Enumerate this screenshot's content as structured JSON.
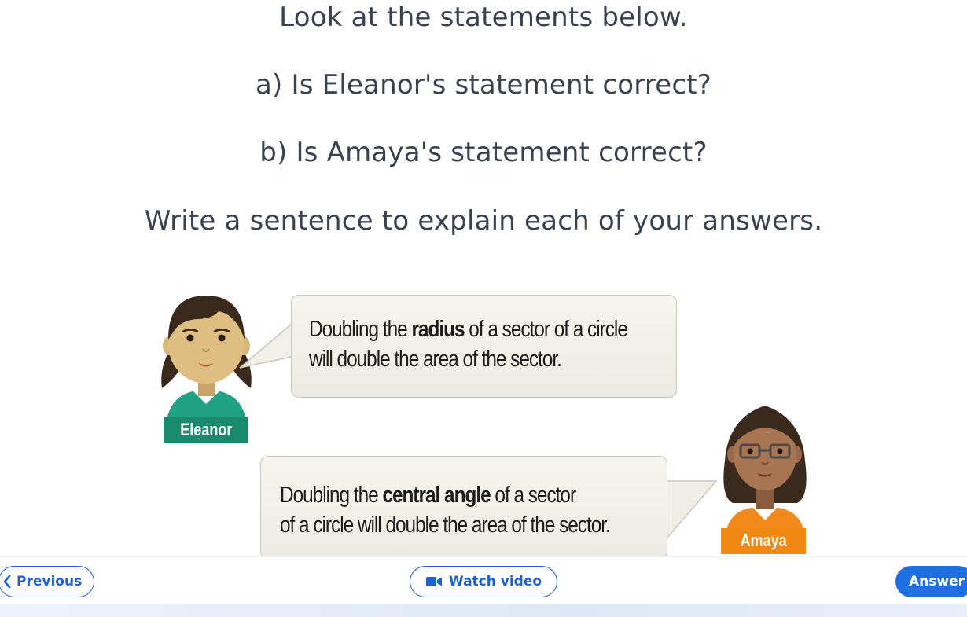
{
  "question": {
    "line1": "Look at the statements below.",
    "line2": "a) Is Eleanor's statement correct?",
    "line3": "b) Is Amaya's statement correct?",
    "line4": "Write a sentence to explain each of your answers."
  },
  "eleanor": {
    "name": "Eleanor",
    "line1_before": "Doubling the ",
    "line1_bold": "radius",
    "line1_after": " of a sector of a circle",
    "line2": "will double the area of the sector."
  },
  "amaya": {
    "name": "Amaya",
    "line1_before": "Doubling the ",
    "line1_bold": "central angle",
    "line1_after": " of a sector",
    "line2": "of a circle will double the area of the sector."
  },
  "footer": {
    "previous_label": "Previous",
    "previous_icon": "chevron-left-icon",
    "video_label": "Watch video",
    "video_icon": "video-camera-icon",
    "answer_label": "Answer"
  },
  "colors": {
    "button_blue": "#1f5fd0",
    "eleanor_tag": "#1a8a6c",
    "amaya_tag": "#f08a14"
  }
}
